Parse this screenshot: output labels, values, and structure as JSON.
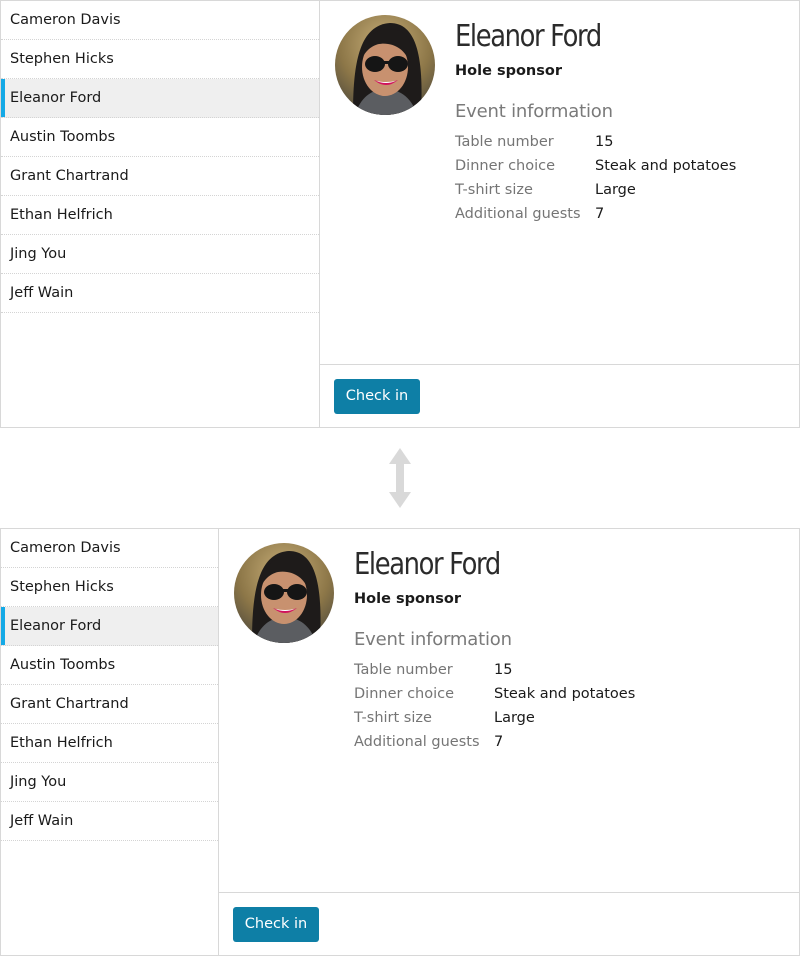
{
  "attendees": [
    {
      "label": "Cameron Davis"
    },
    {
      "label": "Stephen Hicks"
    },
    {
      "label": "Eleanor Ford"
    },
    {
      "label": "Austin Toombs"
    },
    {
      "label": "Grant Chartrand"
    },
    {
      "label": "Ethan Helfrich"
    },
    {
      "label": "Jing You"
    },
    {
      "label": "Jeff Wain"
    }
  ],
  "selected_attendee": "Eleanor Ford",
  "detail": {
    "name": "Eleanor Ford",
    "role": "Hole sponsor",
    "section_title": "Event information",
    "fields": [
      {
        "label": "Table number",
        "value": "15"
      },
      {
        "label": "Dinner choice",
        "value": "Steak and potatoes"
      },
      {
        "label": "T-shirt size",
        "value": "Large"
      },
      {
        "label": "Additional guests",
        "value": "7"
      }
    ],
    "avatar_icon": "profile-photo",
    "check_in_label": "Check in"
  },
  "between_panels_icon": "vertical-resize-arrow-icon",
  "colors": {
    "accent": "#14a9e6",
    "button": "#0e7fa6",
    "selected_bg": "#efefef"
  }
}
